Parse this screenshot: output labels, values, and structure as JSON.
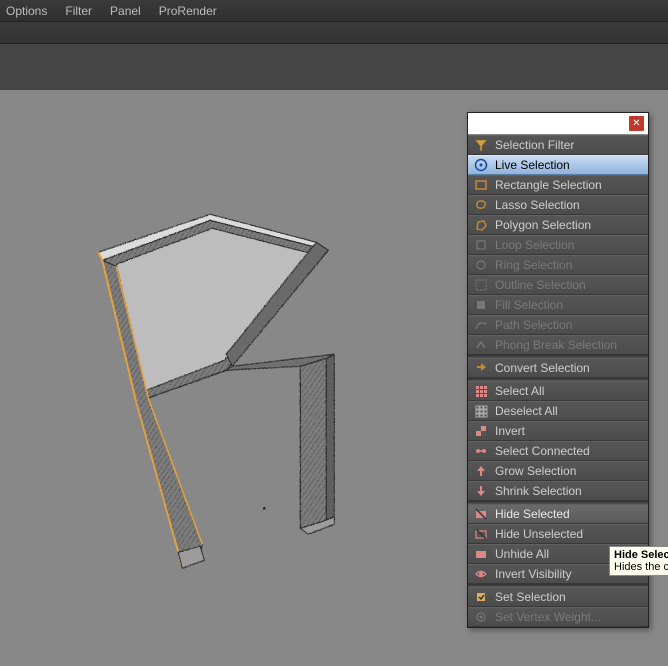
{
  "menubar": {
    "options": "Options",
    "filter": "Filter",
    "panel": "Panel",
    "prorender": "ProRender"
  },
  "panel": {
    "groups": [
      [
        {
          "id": "selection-filter",
          "label": "Selection Filter",
          "icon": "filter",
          "disabled": false
        },
        {
          "id": "live-selection",
          "label": "Live Selection",
          "icon": "circle",
          "disabled": false,
          "selected": true
        },
        {
          "id": "rectangle-selection",
          "label": "Rectangle Selection",
          "icon": "rect",
          "disabled": false
        },
        {
          "id": "lasso-selection",
          "label": "Lasso Selection",
          "icon": "lasso",
          "disabled": false
        },
        {
          "id": "polygon-selection",
          "label": "Polygon Selection",
          "icon": "poly",
          "disabled": false
        },
        {
          "id": "loop-selection",
          "label": "Loop Selection",
          "icon": "loop",
          "disabled": true
        },
        {
          "id": "ring-selection",
          "label": "Ring Selection",
          "icon": "ring",
          "disabled": true
        },
        {
          "id": "outline-selection",
          "label": "Outline Selection",
          "icon": "outline",
          "disabled": true
        },
        {
          "id": "fill-selection",
          "label": "Fill Selection",
          "icon": "fill",
          "disabled": true
        },
        {
          "id": "path-selection",
          "label": "Path Selection",
          "icon": "path",
          "disabled": true
        },
        {
          "id": "phong-break-selection",
          "label": "Phong Break Selection",
          "icon": "phong",
          "disabled": true
        }
      ],
      [
        {
          "id": "convert-selection",
          "label": "Convert Selection",
          "icon": "convert",
          "disabled": false
        }
      ],
      [
        {
          "id": "select-all",
          "label": "Select All",
          "icon": "grid9",
          "disabled": false
        },
        {
          "id": "deselect-all",
          "label": "Deselect All",
          "icon": "grid0",
          "disabled": false
        },
        {
          "id": "invert",
          "label": "Invert",
          "icon": "invert",
          "disabled": false
        },
        {
          "id": "select-connected",
          "label": "Select Connected",
          "icon": "connected",
          "disabled": false
        },
        {
          "id": "grow-selection",
          "label": "Grow Selection",
          "icon": "grow",
          "disabled": false
        },
        {
          "id": "shrink-selection",
          "label": "Shrink Selection",
          "icon": "shrink",
          "disabled": false
        }
      ],
      [
        {
          "id": "hide-selected",
          "label": "Hide Selected",
          "icon": "hide",
          "disabled": false,
          "highlight": true
        },
        {
          "id": "hide-unselected",
          "label": "Hide Unselected",
          "icon": "hideun",
          "disabled": false
        },
        {
          "id": "unhide-all",
          "label": "Unhide All",
          "icon": "unhide",
          "disabled": false
        },
        {
          "id": "invert-visibility",
          "label": "Invert Visibility",
          "icon": "invvis",
          "disabled": false
        }
      ],
      [
        {
          "id": "set-selection",
          "label": "Set Selection",
          "icon": "set",
          "disabled": false
        },
        {
          "id": "set-vertex-weight",
          "label": "Set Vertex Weight...",
          "icon": "weight",
          "disabled": true
        }
      ]
    ]
  },
  "tooltip": {
    "title": "Hide Selecte",
    "body": "Hides the cu"
  }
}
